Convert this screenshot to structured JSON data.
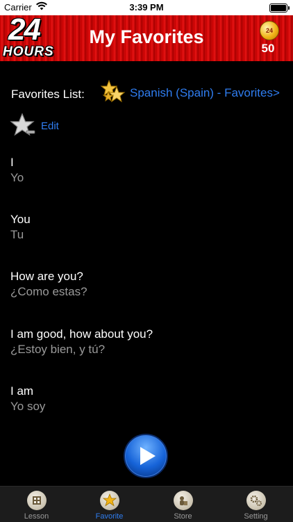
{
  "status_bar": {
    "carrier": "Carrier",
    "time": "3:39 PM"
  },
  "header": {
    "logo": {
      "number": "24",
      "word": "HOURS"
    },
    "title": "My Favorites",
    "coin_count": "50",
    "coin_label": "24"
  },
  "favorites": {
    "label": "Favorites List:",
    "list_link": "Spanish (Spain) - Favorites>",
    "edit_label": "Edit"
  },
  "phrases": [
    {
      "en": "I",
      "es": "Yo"
    },
    {
      "en": "You",
      "es": "Tu"
    },
    {
      "en": "How are you?",
      "es": "¿Como estas?"
    },
    {
      "en": "I am good, how about you?",
      "es": "¿Estoy bien, y tú?"
    },
    {
      "en": "I am",
      "es": "Yo soy"
    }
  ],
  "tabs": [
    {
      "label": "Lesson",
      "icon": "lesson-icon",
      "active": false
    },
    {
      "label": "Favorite",
      "icon": "star-icon",
      "active": true
    },
    {
      "label": "Store",
      "icon": "store-icon",
      "active": false
    },
    {
      "label": "Setting",
      "icon": "gears-icon",
      "active": false
    }
  ],
  "colors": {
    "header_red": "#d20a0a",
    "link_blue": "#2f7df0",
    "secondary_text": "#9a9a9a",
    "tab_bar": "#1c1c1c"
  }
}
